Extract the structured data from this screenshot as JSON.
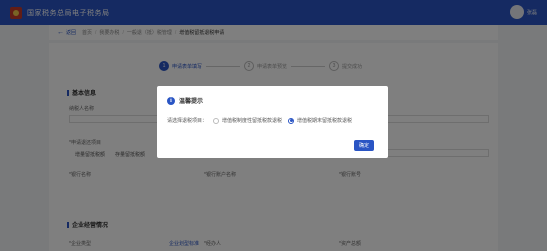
{
  "header": {
    "title": "国家税务总局电子税务局",
    "user_name": "张磊"
  },
  "breadcrumb": {
    "back_label": "返回",
    "items": [
      "首页",
      "我要办税",
      "一般退（抵）税管理"
    ],
    "current": "增值税留抵退税申请"
  },
  "steps": [
    {
      "number": "1",
      "label": "申请表单填写"
    },
    {
      "number": "2",
      "label": "申请表单预览"
    },
    {
      "number": "3",
      "label": "提交成功"
    }
  ],
  "form": {
    "section_basic": "基本信息",
    "taxpayer_name_label": "纳税人名称",
    "refund_project_label": "*申请退还项目",
    "refund_options": [
      "增量留抵税额",
      "存量留抵税额"
    ],
    "bank_name_label": "*银行名称",
    "bank_account_name_label": "*银行账户名称",
    "bank_account_label": "*银行账号",
    "section_business": "企业经营情况",
    "enterprise_type_label": "*企业类型",
    "enterprise_type_link": "企业划型标准",
    "legal_rep_label": "*经办人",
    "loss_label": "*资产总额"
  },
  "dialog": {
    "title": "温馨提示",
    "prompt": "请选择退税项目：",
    "options": [
      {
        "label": "增值税制度性留抵税款退税",
        "checked": false
      },
      {
        "label": "增值税期末留抵税款退税",
        "checked": true
      }
    ],
    "confirm_label": "确定"
  },
  "colors": {
    "primary": "#2a55c4",
    "overlay": "rgba(0,0,0,0.5)"
  }
}
